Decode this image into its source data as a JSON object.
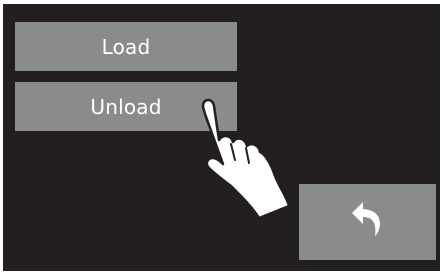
{
  "menu": {
    "load_label": "Load",
    "unload_label": "Unload"
  },
  "navigation": {
    "back_icon": "back-arrow-icon"
  },
  "overlay": {
    "pointer_icon": "pointing-hand-icon"
  },
  "colors": {
    "screen_background": "#231f20",
    "button_background": "#8a8b8d",
    "text": "#ffffff",
    "hand_fill": "#ffffff",
    "hand_outline": "#231f20"
  }
}
